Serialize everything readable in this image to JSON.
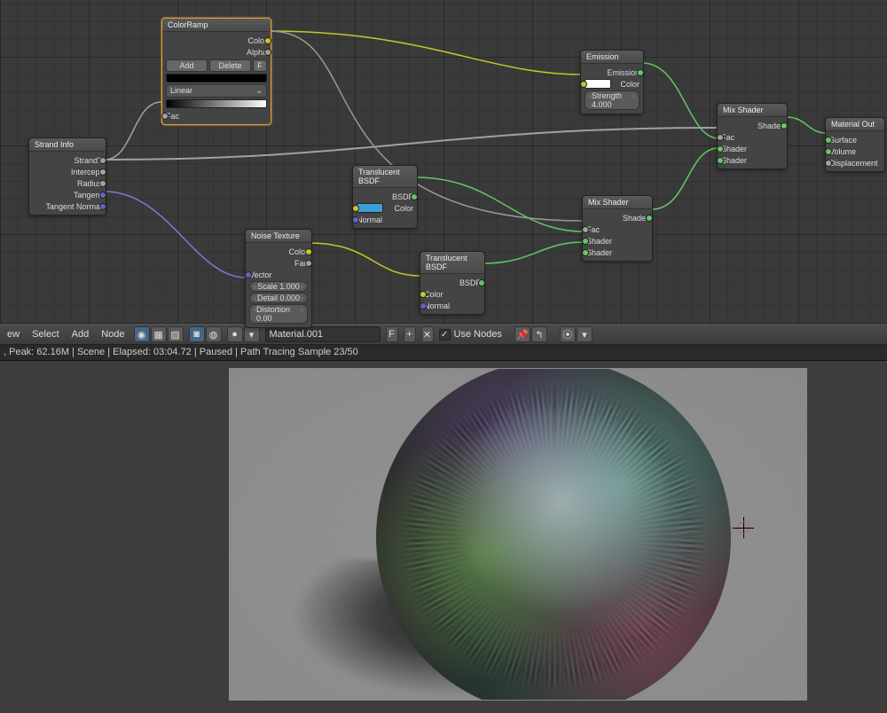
{
  "nodes": {
    "strand_info": {
      "title": "Strand Info",
      "outputs": [
        "Strand?",
        "Intercept",
        "Radius",
        "Tangent",
        "Tangent Normal"
      ]
    },
    "color_ramp": {
      "title": "ColorRamp",
      "add": "Add",
      "delete": "Delete",
      "f": "F",
      "mode": "Linear",
      "fac": "Fac",
      "outputs": [
        "Color",
        "Alpha"
      ]
    },
    "noise": {
      "title": "Noise Texture",
      "outputs": [
        "Color",
        "Fac"
      ],
      "vector": "Vector",
      "scale_lbl": "Scale",
      "scale_val": "1.000",
      "detail_lbl": "Detail",
      "detail_val": "0.000",
      "distortion_lbl": "Distortion",
      "distortion_val": "0.00"
    },
    "translucent1": {
      "title": "Translucent BSDF",
      "out": "BSDF",
      "color": "Color",
      "normal": "Normal",
      "swatch": "#3aa0d4"
    },
    "translucent2": {
      "title": "Translucent BSDF",
      "out": "BSDF",
      "color": "Color",
      "normal": "Normal"
    },
    "emission": {
      "title": "Emission",
      "out": "Emission",
      "color": "Color",
      "strength_lbl": "Strength",
      "strength_val": "4.000",
      "swatch": "#ffffff"
    },
    "mix1": {
      "title": "Mix Shader",
      "out": "Shader",
      "fac": "Fac",
      "sh1": "Shader",
      "sh2": "Shader"
    },
    "mix2": {
      "title": "Mix Shader",
      "out": "Shader",
      "fac": "Fac",
      "sh1": "Shader",
      "sh2": "Shader"
    },
    "material_out": {
      "title": "Material Out",
      "surface": "Surface",
      "volume": "Volume",
      "displacement": "Displacement"
    }
  },
  "header": {
    "menus": [
      "ew",
      "Select",
      "Add",
      "Node"
    ],
    "material": "Material.001",
    "use_nodes": "Use Nodes"
  },
  "status": ", Peak: 62.16M | Scene | Elapsed: 03:04.72 | Paused | Path Tracing Sample 23/50"
}
